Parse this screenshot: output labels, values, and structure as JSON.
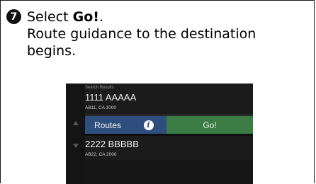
{
  "step": {
    "number": "7",
    "line_prefix": "Select ",
    "bold_word": "Go!",
    "line_suffix": ".",
    "description": "Route guidance to the destination begins."
  },
  "screen": {
    "header": "Search Results",
    "results": [
      {
        "name": "1111 AAAAA",
        "address": "AB11, CA 1000"
      },
      {
        "name": "2222 BBBBB",
        "address": "AB22, CA 2000"
      }
    ],
    "buttons": {
      "routes": "Routes",
      "info_icon": "info-icon",
      "go": "Go!"
    },
    "colors": {
      "bar": "#2e4f7e",
      "go": "#3b7b44",
      "background": "#1b1b1b"
    }
  }
}
